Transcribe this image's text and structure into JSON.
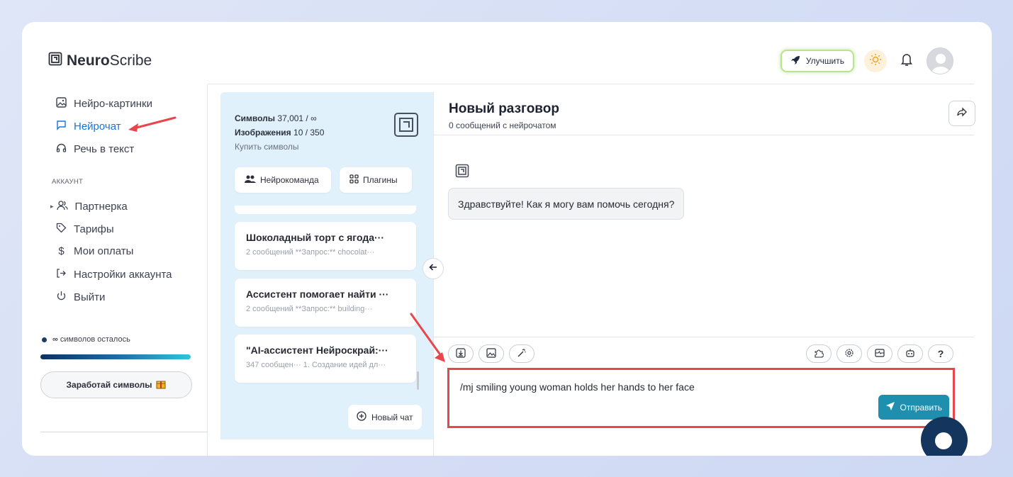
{
  "brand": {
    "name_bold": "Neuro",
    "name_rest": "Scribe"
  },
  "header": {
    "upgrade_label": "Улучшить"
  },
  "sidebar": {
    "items": [
      {
        "label": "Нейро-картинки",
        "icon": "image-icon"
      },
      {
        "label": "Нейрочат",
        "icon": "chat-icon",
        "active": true
      },
      {
        "label": "Речь в текст",
        "icon": "headphones-icon"
      }
    ],
    "section_label": "АККАУНТ",
    "account_items": [
      {
        "label": "Партнерка",
        "icon": "users-icon"
      },
      {
        "label": "Тарифы",
        "icon": "tag-icon"
      },
      {
        "label": "Мои оплаты",
        "icon": "dollar-icon"
      },
      {
        "label": "Настройки аккаунта",
        "icon": "sign-in-icon"
      },
      {
        "label": "Выйти",
        "icon": "power-icon"
      }
    ],
    "symbols_left": "символов осталось",
    "symbols_infinity": "∞",
    "earn_button": "Заработай символы"
  },
  "panel": {
    "symbols_label": "Символы",
    "symbols_value": "37,001 / ∞",
    "images_label": "Изображения",
    "images_value": "10 / 350",
    "buy_link": "Купить символы",
    "team_button": "Нейрокоманда",
    "plugins_button": "Плагины",
    "chats": [
      {
        "title": "Шоколадный торт с ягода···",
        "meta": "2 сообщений   **Запрос:** chocolat···"
      },
      {
        "title": "Ассистент помогает найти ···",
        "meta": "2 сообщений   **Запрос:** building···"
      },
      {
        "title": "\"AI-ассистент Нейроскрай:···",
        "meta": "347 сообщен··· 1. Создание идей дл···"
      }
    ],
    "new_chat_button": "Новый чат"
  },
  "chat": {
    "title": "Новый разговор",
    "subtitle": "0 сообщений с нейрочатом",
    "greeting": "Здравствуйте! Как я могу вам помочь сегодня?",
    "input_value": "/mj smiling young woman holds her hands to her face",
    "send_label": "Отправить",
    "help_label": "?"
  },
  "colors": {
    "accent": "#1e8fae",
    "active_nav": "#1a73d9",
    "highlight": "#e7474c",
    "panel_bg": "#e1f1fb"
  }
}
